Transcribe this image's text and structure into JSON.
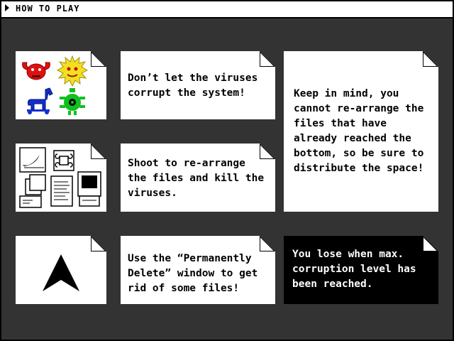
{
  "window": {
    "title": "HOW TO PLAY"
  },
  "cards": {
    "viruses_text": "Don’t let the viruses\ncorrupt the system!",
    "shoot_text": "Shoot to re-arrange\nthe files and kill the\nviruses.",
    "keep_in_mind_text": "Keep in mind, you\ncannot re-arrange the\nfiles that have\nalready reached the\nbottom, so be sure to\ndistribute the space!",
    "delete_text": "Use the “Permanently\nDelete” window to get\nrid of some files!",
    "lose_text": "You lose when max.\ncorruption level has\nbeen reached."
  },
  "icons": {
    "virus_red": "red-horned-virus-icon",
    "virus_yellow": "yellow-spiky-virus-icon",
    "virus_blue": "blue-horse-virus-icon",
    "virus_green": "green-bug-virus-icon",
    "files": "files-icon-collage",
    "ship": "arrow-ship-icon"
  },
  "colors": {
    "virus_red": "#e01010",
    "virus_yellow": "#f2e020",
    "virus_blue": "#1030d0",
    "virus_green": "#10c020",
    "background_pattern": "#000000"
  }
}
